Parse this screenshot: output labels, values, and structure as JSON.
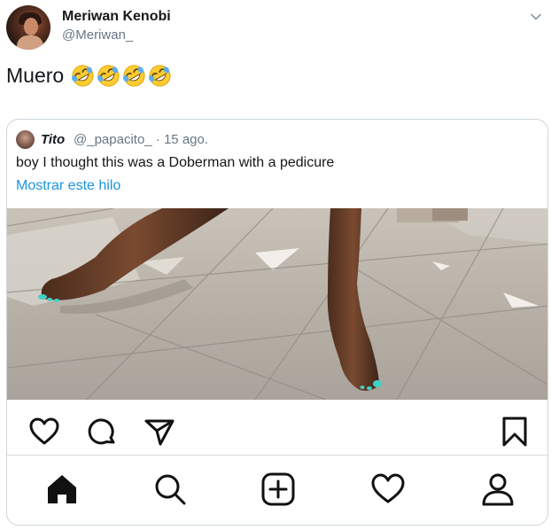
{
  "tweet": {
    "author_name": "Meriwan Kenobi",
    "author_handle": "@Meriwan_",
    "text": "Muero",
    "emojis": [
      "rolling-on-floor-laughing",
      "rolling-on-floor-laughing",
      "rolling-on-floor-laughing",
      "rolling-on-floor-laughing"
    ]
  },
  "quoted": {
    "name": "Tito",
    "handle": "@_papacito_",
    "separator": "·",
    "date": "15 ago.",
    "text": "boy I thought this was a Doberman with a pedicure",
    "link": "Mostrar este hilo"
  },
  "icons": {
    "menu": "chevron-down-icon",
    "post_actions": [
      "heart-icon",
      "comment-icon",
      "send-icon",
      "bookmark-icon"
    ],
    "nav": [
      "home-icon",
      "search-icon",
      "add-post-icon",
      "activity-heart-icon",
      "profile-icon"
    ]
  },
  "colors": {
    "link": "#1b95e0",
    "muted": "#657786",
    "text": "#14171a",
    "border": "#ccd6dd",
    "nail_polish": "#3fd1c8"
  }
}
